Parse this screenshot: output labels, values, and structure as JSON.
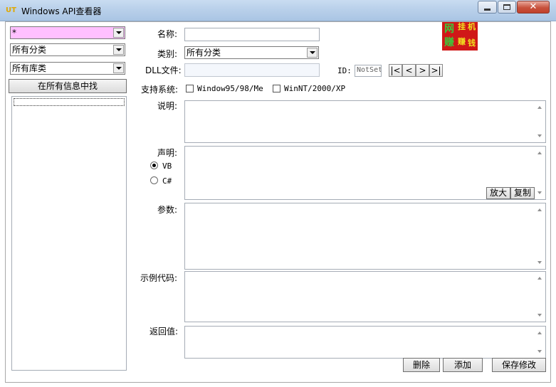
{
  "window": {
    "title": "Windows API查看器",
    "icon": "app-icon"
  },
  "sidebar": {
    "search_value": "*",
    "search_bg": "#ffc0ff",
    "category_value": "所有分类",
    "library_value": "所有库类",
    "search_all_button": "在所有信息中找"
  },
  "form": {
    "name_label": "名称:",
    "category_label": "类别:",
    "category_value": "所有分类",
    "dll_label": "DLL文件:",
    "id_label": "ID:",
    "id_value": "NotSet",
    "nav": [
      "|<",
      "<",
      ">",
      ">|"
    ],
    "system_label": "支持系统:",
    "win95_label": "Window95/98/Me",
    "winnt_label": "WinNT/2000/XP",
    "desc_label": "说明:",
    "decl_label": "声明:",
    "vb_label": "VB",
    "cs_label": "C#",
    "zoom_button": "放大",
    "copy_button": "复制",
    "params_label": "参数:",
    "example_label": "示例代码:",
    "return_label": "返回值:"
  },
  "buttons": {
    "delete": "删除",
    "add": "添加",
    "save": "保存修改"
  },
  "logo": {
    "chars": [
      "网",
      "挂",
      "机",
      "赚",
      "赚",
      "钱"
    ],
    "bg_color": "#d01818",
    "fg_green": "#3cc83c",
    "fg_yellow": "#f0e020"
  }
}
